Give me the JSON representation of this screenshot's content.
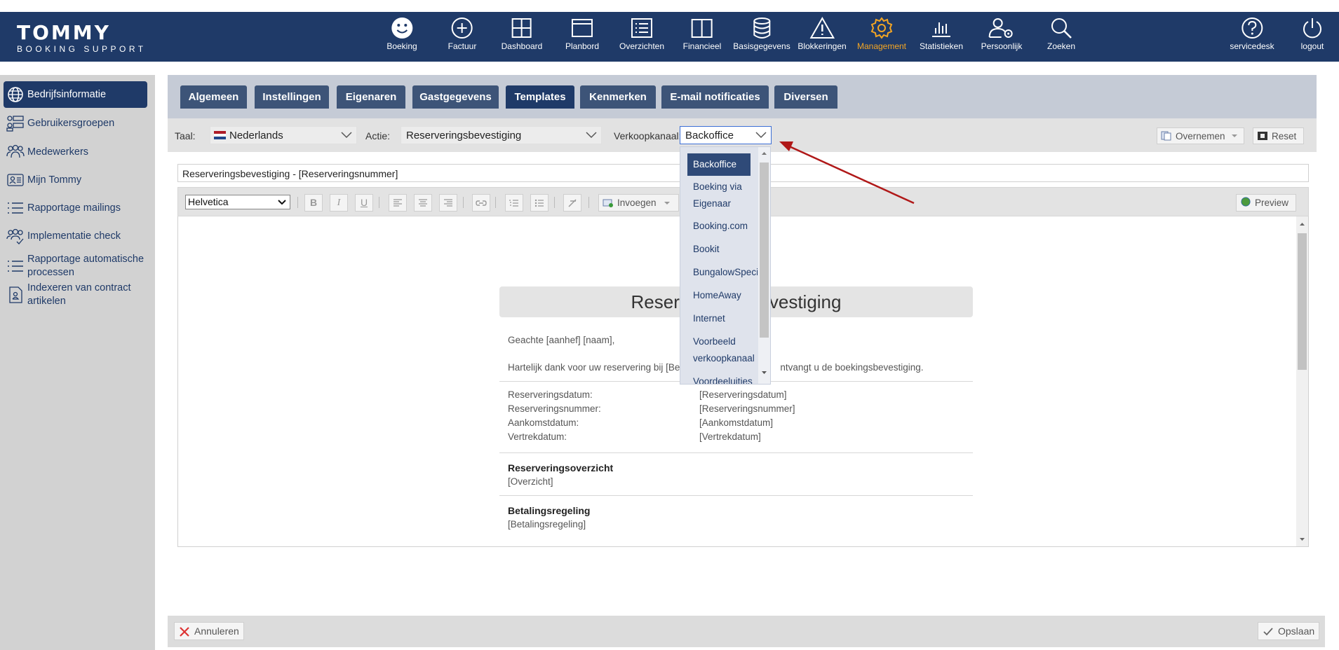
{
  "brand": {
    "name": "TOMMY",
    "tagline": "BOOKING SUPPORT"
  },
  "nav": [
    {
      "label": "Boeking",
      "icon": "smiley-icon"
    },
    {
      "label": "Factuur",
      "icon": "plus-circle-icon"
    },
    {
      "label": "Dashboard",
      "icon": "grid-icon"
    },
    {
      "label": "Planbord",
      "icon": "window-icon"
    },
    {
      "label": "Overzichten",
      "icon": "list-icon"
    },
    {
      "label": "Financieel",
      "icon": "book-icon"
    },
    {
      "label": "Basisgegevens",
      "icon": "database-icon"
    },
    {
      "label": "Blokkeringen",
      "icon": "warning-icon"
    },
    {
      "label": "Management",
      "icon": "gear-icon",
      "active": true
    },
    {
      "label": "Statistieken",
      "icon": "bar-chart-icon"
    },
    {
      "label": "Persoonlijk",
      "icon": "user-gear-icon"
    },
    {
      "label": "Zoeken",
      "icon": "search-icon"
    }
  ],
  "nav_right": [
    {
      "label": "servicedesk",
      "icon": "help-icon"
    },
    {
      "label": "logout",
      "icon": "power-icon"
    }
  ],
  "sidebar": {
    "items": [
      {
        "label": "Bedrijfsinformatie",
        "icon": "globe-icon",
        "active": true
      },
      {
        "label": "Gebruikersgroepen",
        "icon": "groups-icon"
      },
      {
        "label": "Medewerkers",
        "icon": "people-icon"
      },
      {
        "label": "Mijn Tommy",
        "icon": "id-card-icon"
      },
      {
        "label": "Rapportage mailings",
        "icon": "list-icon"
      },
      {
        "label": "Implementatie check",
        "icon": "people-check-icon"
      },
      {
        "label": "Rapportage automatische processen",
        "icon": "list-icon"
      },
      {
        "label": "Indexeren van contract artikelen",
        "icon": "contract-icon"
      }
    ]
  },
  "tabs": [
    {
      "label": "Algemeen"
    },
    {
      "label": "Instellingen"
    },
    {
      "label": "Eigenaren"
    },
    {
      "label": "Gastgegevens"
    },
    {
      "label": "Templates",
      "active": true
    },
    {
      "label": "Kenmerken"
    },
    {
      "label": "E-mail notificaties"
    },
    {
      "label": "Diversen"
    }
  ],
  "filters": {
    "taal_label": "Taal:",
    "taal_value": "Nederlands",
    "actie_label": "Actie:",
    "actie_value": "Reserveringsbevestiging",
    "kanaal_label": "Verkoopkanaal:",
    "kanaal_value": "Backoffice",
    "overnemen": "Overnemen",
    "reset": "Reset"
  },
  "dropdown": {
    "options": [
      "Backoffice",
      "Boeking via Eigenaar",
      "Booking.com",
      "Bookit",
      "BungalowSpecials",
      "HomeAway",
      "Internet",
      "Voorbeeld verkoopkanaal",
      "Voordeeluitjes"
    ],
    "selected": "Backoffice"
  },
  "subject": "Reserveringsbevestiging - [Reserveringsnummer]",
  "toolbar": {
    "font": "Helvetica",
    "bold": "B",
    "italic": "I",
    "underline": "U",
    "insert": "Invoegen",
    "preview": "Preview"
  },
  "template": {
    "title_left": "Reser",
    "title_right": "vestiging",
    "greeting": "Geachte [aanhef] [naam],",
    "thanks_left": "Hartelijk dank voor uw reservering bij [Be",
    "thanks_right": "ntvangt u de boekingsbevestiging.",
    "fields": [
      {
        "label": "Reserveringsdatum:",
        "value": "[Reserveringsdatum]"
      },
      {
        "label": "Reserveringsnummer:",
        "value": "[Reserveringsnummer]"
      },
      {
        "label": "Aankomstdatum:",
        "value": "[Aankomstdatum]"
      },
      {
        "label": "Vertrekdatum:",
        "value": "[Vertrekdatum]"
      }
    ],
    "overview_title": "Reserveringsoverzicht",
    "overview_value": "[Overzicht]",
    "payment_title": "Betalingsregeling",
    "payment_value": "[Betalingsregeling]"
  },
  "footer": {
    "cancel": "Annuleren",
    "save": "Opslaan"
  },
  "colors": {
    "navy": "#1f3a68",
    "accent": "#f5a623",
    "arrow": "#b01818"
  }
}
